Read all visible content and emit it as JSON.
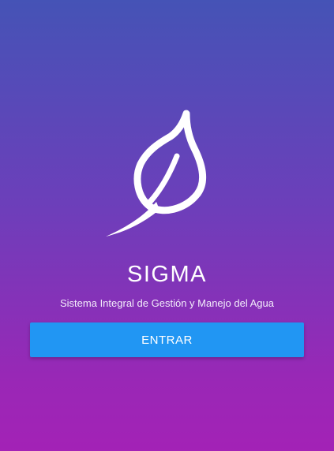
{
  "app": {
    "title": "SIGMA",
    "subtitle": "Sistema Integral de Gestión y Manejo del Agua"
  },
  "logo": {
    "icon": "leaf-icon",
    "color": "#ffffff"
  },
  "actions": {
    "enter_label": "ENTRAR"
  },
  "colors": {
    "gradient_top": "#4553b6",
    "gradient_bottom": "#a322b6",
    "button": "#2196f3",
    "text": "#ffffff"
  }
}
